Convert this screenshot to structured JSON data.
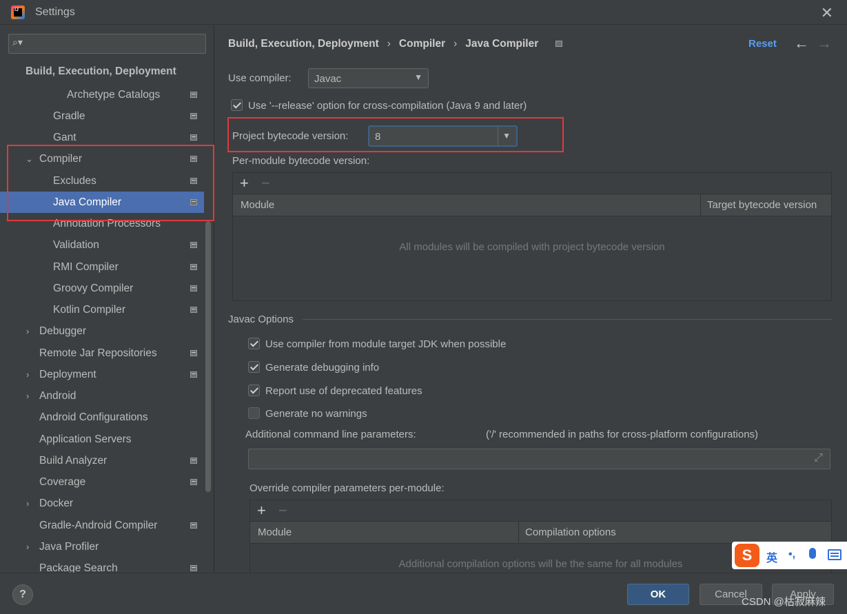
{
  "window": {
    "title": "Settings",
    "close_glyph": "✕",
    "logo_text": "IJ"
  },
  "sidebar": {
    "search": {
      "value": "",
      "placeholder": ""
    },
    "items": [
      {
        "label": "Build, Execution, Deployment"
      },
      {
        "label": "Archetype Catalogs"
      },
      {
        "label": "Gradle"
      },
      {
        "label": "Gant"
      },
      {
        "label": "Compiler"
      },
      {
        "label": "Excludes"
      },
      {
        "label": "Java Compiler"
      },
      {
        "label": "Annotation Processors"
      },
      {
        "label": "Validation"
      },
      {
        "label": "RMI Compiler"
      },
      {
        "label": "Groovy Compiler"
      },
      {
        "label": "Kotlin Compiler"
      },
      {
        "label": "Debugger"
      },
      {
        "label": "Remote Jar Repositories"
      },
      {
        "label": "Deployment"
      },
      {
        "label": "Android"
      },
      {
        "label": "Android Configurations"
      },
      {
        "label": "Application Servers"
      },
      {
        "label": "Build Analyzer"
      },
      {
        "label": "Coverage"
      },
      {
        "label": "Docker"
      },
      {
        "label": "Gradle-Android Compiler"
      },
      {
        "label": "Java Profiler"
      },
      {
        "label": "Package Search"
      }
    ]
  },
  "main": {
    "breadcrumb": [
      "Build, Execution, Deployment",
      "Compiler",
      "Java Compiler"
    ],
    "breadcrumb_sep": "›",
    "reset_label": "Reset",
    "nav_back": "←",
    "nav_forward": "→",
    "use_compiler": {
      "label": "Use compiler:",
      "value": "Javac"
    },
    "release_option": {
      "label": "Use '--release' option for cross-compilation (Java 9 and later)",
      "checked": true
    },
    "project_bytecode": {
      "label": "Project bytecode version:",
      "value": "8"
    },
    "per_module": {
      "label": "Per-module bytecode version:",
      "add": "+",
      "remove": "−",
      "columns": [
        "Module",
        "Target bytecode version"
      ],
      "empty_text": "All modules will be compiled with project bytecode version"
    },
    "javac_options": {
      "title": "Javac Options",
      "checks": [
        {
          "label": "Use compiler from module target JDK when possible",
          "checked": true
        },
        {
          "label": "Generate debugging info",
          "checked": true
        },
        {
          "label": "Report use of deprecated features",
          "checked": true
        },
        {
          "label": "Generate no warnings",
          "checked": false
        }
      ],
      "additional_label": "Additional command line parameters:",
      "additional_hint": "('/' recommended in paths for cross-platform configurations)",
      "additional_value": "",
      "expand_glyph": "⤢",
      "override": {
        "label": "Override compiler parameters per-module:",
        "add": "+",
        "remove": "−",
        "columns": [
          "Module",
          "Compilation options"
        ],
        "empty_text": "Additional compilation options will be the same for all modules"
      }
    }
  },
  "footer": {
    "help": "?",
    "ok": "OK",
    "cancel": "Cancel",
    "apply": "Apply"
  },
  "ime": {
    "logo": "S",
    "lang": "英",
    "punct": "•,",
    "accent": "#f35b1a"
  },
  "watermark": "CSDN @枯寂麻辣",
  "colors": {
    "selected": "#4b6eaf",
    "link": "#589df6",
    "highlight_box": "#e0393e",
    "primary_button": "#365880"
  }
}
